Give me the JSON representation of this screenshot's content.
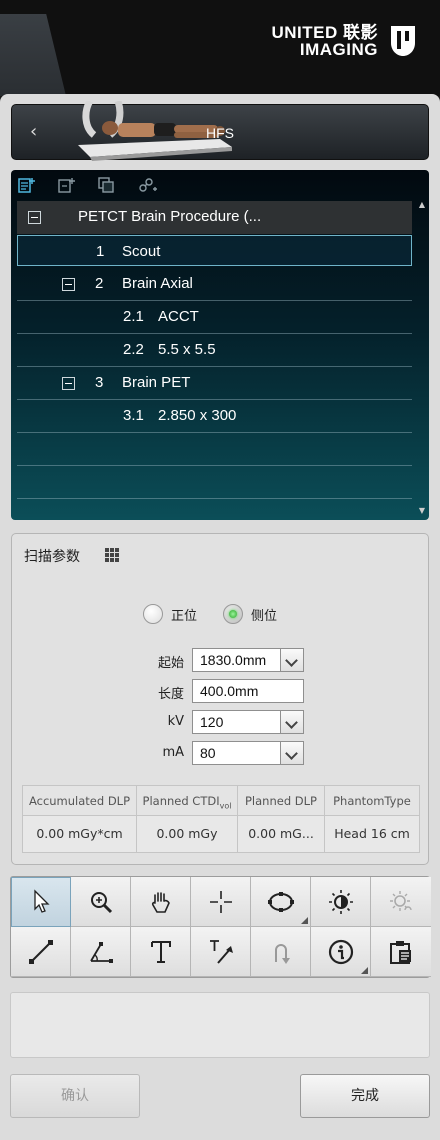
{
  "brand": {
    "line1": "UNITED 联影",
    "line2": "IMAGING"
  },
  "patient": {
    "back_label": "‹",
    "position": "HFS"
  },
  "tree": {
    "tool_icons": [
      "add-series-icon",
      "insert-series-icon",
      "copy-series-icon",
      "link-series-icon"
    ],
    "procedure": "PETCT Brain Procedure (...",
    "rows": [
      {
        "num": "1",
        "text": "Scout"
      },
      {
        "num": "2",
        "text": "Brain Axial"
      },
      {
        "num": "2.1",
        "text": "ACCT"
      },
      {
        "num": "2.2",
        "text": "5.5 x 5.5"
      },
      {
        "num": "3",
        "text": "Brain PET"
      },
      {
        "num": "3.1",
        "text": "2.850 x 300"
      }
    ]
  },
  "params": {
    "title": "扫描参数",
    "radio_ap": "正位",
    "radio_lat": "侧位",
    "selected": "侧位",
    "start_label": "起始",
    "start_value": "1830.0mm",
    "length_label": "长度",
    "length_value": "400.0mm",
    "kv_label": "kV",
    "kv_value": "120",
    "ma_label": "mA",
    "ma_value": "80"
  },
  "dose": {
    "headers": [
      "Accumulated DLP",
      "Planned CTDI",
      "Planned DLP",
      "PhantomType"
    ],
    "ctdi_sub": "vol",
    "values": [
      "0.00 mGy*cm",
      "0.00 mGy",
      "0.00 mG...",
      "Head 16 cm"
    ]
  },
  "tools": [
    "pointer-icon",
    "zoom-icon",
    "pan-hand-icon",
    "crosshair-icon",
    "ellipse-roi-icon",
    "window-level-icon",
    "window-preset-icon",
    "line-measure-icon",
    "angle-measure-icon",
    "text-annotation-icon",
    "arrow-annotation-icon",
    "undo-icon",
    "info-icon",
    "clipboard-icon"
  ],
  "buttons": {
    "confirm": "确认",
    "done": "完成"
  },
  "colors": {
    "tree_gradient_top": "#02090f",
    "tree_gradient_bottom": "#0b4e58",
    "selection_border": "#6fb4c9",
    "radio_active": "#27a327"
  }
}
